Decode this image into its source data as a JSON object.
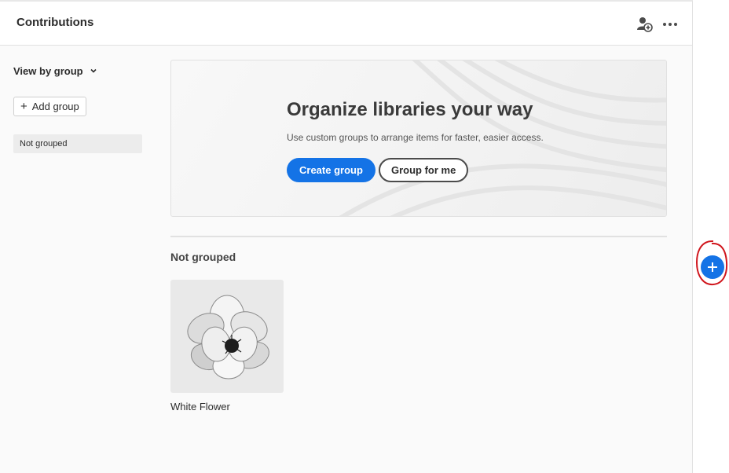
{
  "header": {
    "title": "Contributions",
    "icons": [
      "invite-user-icon",
      "more-options-icon"
    ]
  },
  "sidebar": {
    "view_label": "View by group",
    "add_group_label": "Add group",
    "items": [
      {
        "label": "Not grouped",
        "selected": true
      }
    ]
  },
  "banner": {
    "title": "Organize libraries your way",
    "subtitle": "Use custom groups to arrange items for faster, easier access.",
    "primary_button": "Create group",
    "secondary_button": "Group for me"
  },
  "section": {
    "title": "Not grouped",
    "assets": [
      {
        "name": "White Flower"
      }
    ]
  },
  "colors": {
    "accent": "#1473e6",
    "annotation": "#d0161d"
  }
}
